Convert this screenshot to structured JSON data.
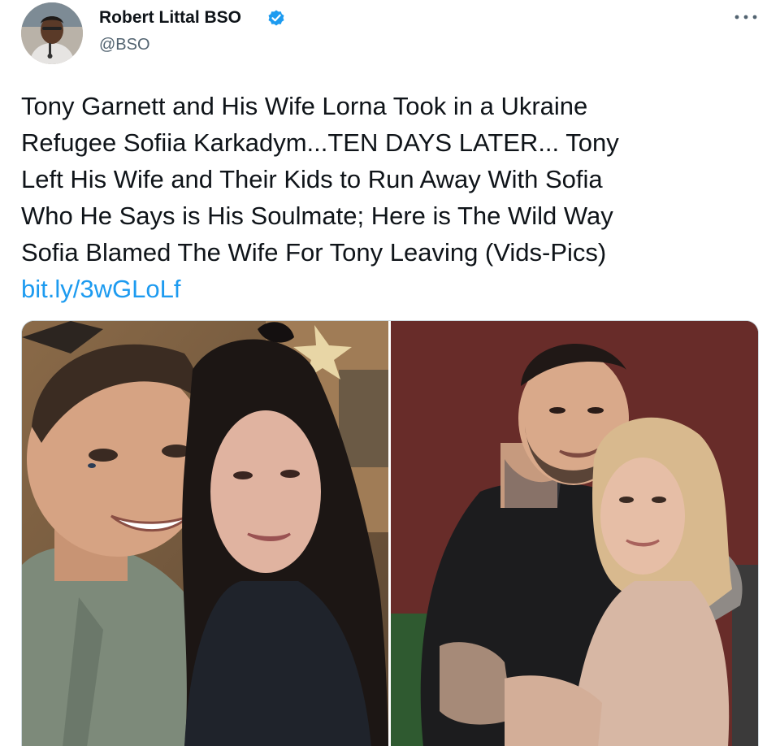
{
  "tweet": {
    "author": {
      "name": "Robert Littal BSO",
      "handle": "@BSO",
      "verified": true,
      "avatar_icon": "avatar-photo"
    },
    "more_icon": "more-horizontal-icon",
    "text_lines": [
      "Tony Garnett and His Wife Lorna Took in a Ukraine",
      "Refugee Sofiia Karkadym...TEN DAYS LATER... Tony",
      "Left His Wife and Their Kids to Run Away With Sofia",
      "Who He Says is His Soulmate; Here is The Wild Way",
      "Sofia Blamed The Wife For Tony Leaving (Vids-Pics)"
    ],
    "link": "bit.ly/3wGLoLf",
    "media": {
      "photos": [
        {
          "icon": "couple-selfie-photo"
        },
        {
          "icon": "couple-embrace-photo"
        }
      ]
    }
  },
  "colors": {
    "text": "#0f1419",
    "secondary_text": "#536471",
    "link": "#1d9bf0",
    "verified_badge": "#1d9bf0",
    "background": "#ffffff"
  }
}
